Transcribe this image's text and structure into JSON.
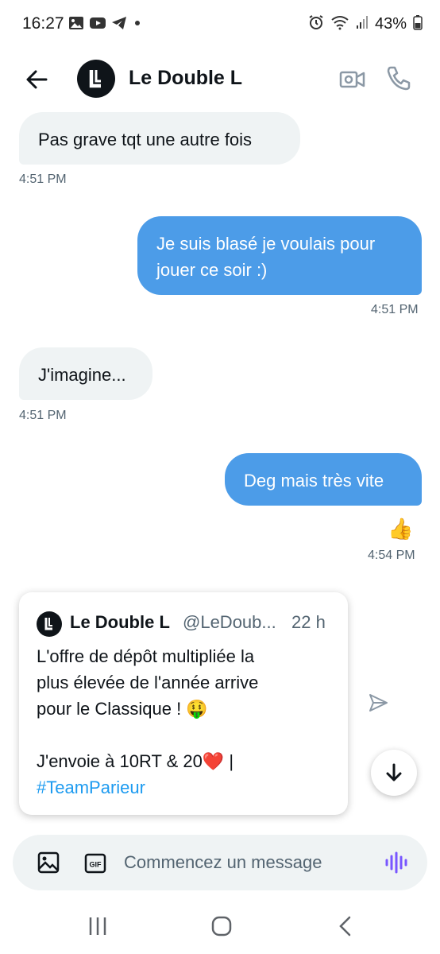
{
  "status_bar": {
    "time": "16:27",
    "battery": "43%",
    "icons_left": [
      "gallery-icon",
      "youtube-icon",
      "telegram-icon",
      "dot-icon"
    ],
    "icons_right": [
      "alarm-icon",
      "wifi-icon",
      "signal-icon",
      "battery-icon"
    ]
  },
  "header": {
    "title": "Le Double L",
    "avatar_letter": "L"
  },
  "messages": [
    {
      "direction": "in",
      "lines": [
        "Pas grave tqt une autre fois"
      ],
      "time": "4:51 PM"
    },
    {
      "direction": "out",
      "lines": [
        "Je suis blasé je voulais pour",
        "jouer ce soir :)"
      ],
      "time": "4:51 PM"
    },
    {
      "direction": "in",
      "lines": [
        "J'imagine..."
      ],
      "time": "4:51 PM"
    },
    {
      "direction": "out",
      "lines": [
        "Deg mais très vite"
      ],
      "time": "4:54 PM",
      "reaction": "👍"
    }
  ],
  "tweet": {
    "author": "Le Double L",
    "handle": "@LeDoub...",
    "age": "22 h",
    "lines": [
      "L'offre de dépôt multipliée la",
      "plus élevée de l'année arrive",
      "pour le Classique ! 🤑",
      "",
      "J'envoie à 10RT & 20❤️ |"
    ],
    "hashtag": "#TeamParieur"
  },
  "composer": {
    "placeholder": "Commencez un message",
    "gif_label": "GIF"
  },
  "colors": {
    "outgoing_bubble": "#4c9ce8",
    "incoming_bubble": "#eff3f4",
    "hashtag": "#1d9bf0",
    "voice_icon": "#7856ff"
  }
}
